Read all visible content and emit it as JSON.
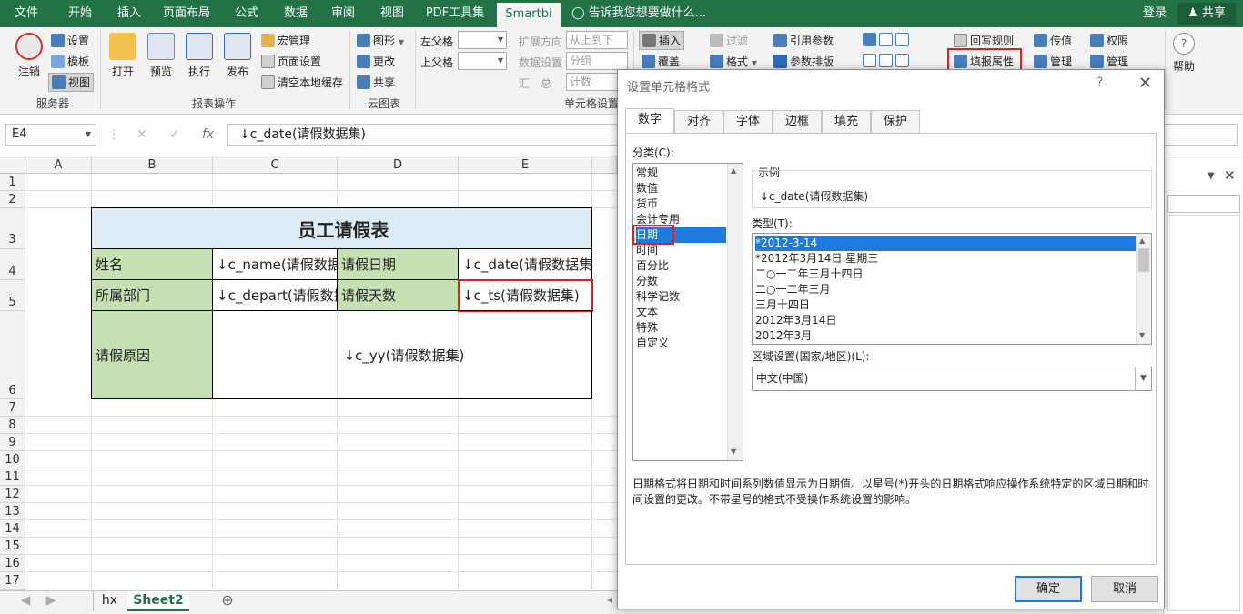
{
  "ribbon_tabs": [
    "文件",
    "开始",
    "插入",
    "页面布局",
    "公式",
    "数据",
    "审阅",
    "视图",
    "PDF工具集",
    "Smartbi"
  ],
  "tell_me": "告诉我您想要做什么...",
  "account": {
    "login": "登录",
    "share": "共享"
  },
  "ribbon": {
    "server": {
      "logout": "注销",
      "settings": "设置",
      "template": "模板",
      "view": "视图",
      "group": "服务器"
    },
    "report": {
      "open": "打开",
      "preview": "预览",
      "execute": "执行",
      "publish": "发布",
      "macro": "宏管理",
      "page_setup": "页面设置",
      "clear_cache": "清空本地缓存",
      "group": "报表操作"
    },
    "cloud": {
      "chart": "图形",
      "change": "更改",
      "share": "共享",
      "group": "云图表"
    },
    "cell": {
      "left_parent": "左父格",
      "top_parent": "上父格",
      "expand_dir": "扩展方向",
      "expand_val": "从上到下",
      "data_setting": "数据设置",
      "group_val": "分组",
      "summary": "汇　总",
      "summary_val": "计数",
      "group": "单元格设置"
    },
    "more": {
      "insert": "插入",
      "cover": "覆盖",
      "filter": "过滤",
      "format": "格式",
      "ref_param": "引用参数",
      "param_layout": "参数排版",
      "writeback_rule": "回写规则",
      "fill_prop": "填报属性",
      "transfer": "传值",
      "manage": "管理",
      "permission": "权限",
      "manage2": "管理",
      "help": "帮助"
    }
  },
  "namebox": "E4",
  "formula": "↓c_date(请假数据集)",
  "columns": [
    "A",
    "B",
    "C",
    "D",
    "E"
  ],
  "rows": [
    "1",
    "2",
    "3",
    "4",
    "5",
    "6",
    "7",
    "8",
    "9",
    "10",
    "11",
    "12",
    "13",
    "14",
    "15",
    "16",
    "17"
  ],
  "table": {
    "title": "员工请假表",
    "name_label": "姓名",
    "name_val": "↓c_name(请假数据集)",
    "date_label": "请假日期",
    "date_val": "↓c_date(请假数据集)",
    "dept_label": "所属部门",
    "dept_val": "↓c_depart(请假数据集)",
    "days_label": "请假天数",
    "days_val": "↓c_ts(请假数据集)",
    "reason_label": "请假原因",
    "reason_val": "↓c_yy(请假数据集)"
  },
  "sheets": [
    "hx",
    "Sheet2"
  ],
  "dialog": {
    "title": "设置单元格格式",
    "tabs": [
      "数字",
      "对齐",
      "字体",
      "边框",
      "填充",
      "保护"
    ],
    "category_label": "分类(C):",
    "categories": [
      "常规",
      "数值",
      "货币",
      "会计专用",
      "日期",
      "时间",
      "百分比",
      "分数",
      "科学记数",
      "文本",
      "特殊",
      "自定义"
    ],
    "sample_label": "示例",
    "sample_val": "↓c_date(请假数据集)",
    "type_label": "类型(T):",
    "types": [
      "*2012-3-14",
      "*2012年3月14日 星期三",
      "二○一二年三月十四日",
      "二○一二年三月",
      "三月十四日",
      "2012年3月14日",
      "2012年3月"
    ],
    "locale_label": "区域设置(国家/地区)(L):",
    "locale_val": "中文(中国)",
    "description": "日期格式将日期和时间系列数值显示为日期值。以星号(*)开头的日期格式响应操作系统特定的区域日期和时间设置的更改。不带星号的格式不受操作系统设置的影响。",
    "ok": "确定",
    "cancel": "取消"
  }
}
